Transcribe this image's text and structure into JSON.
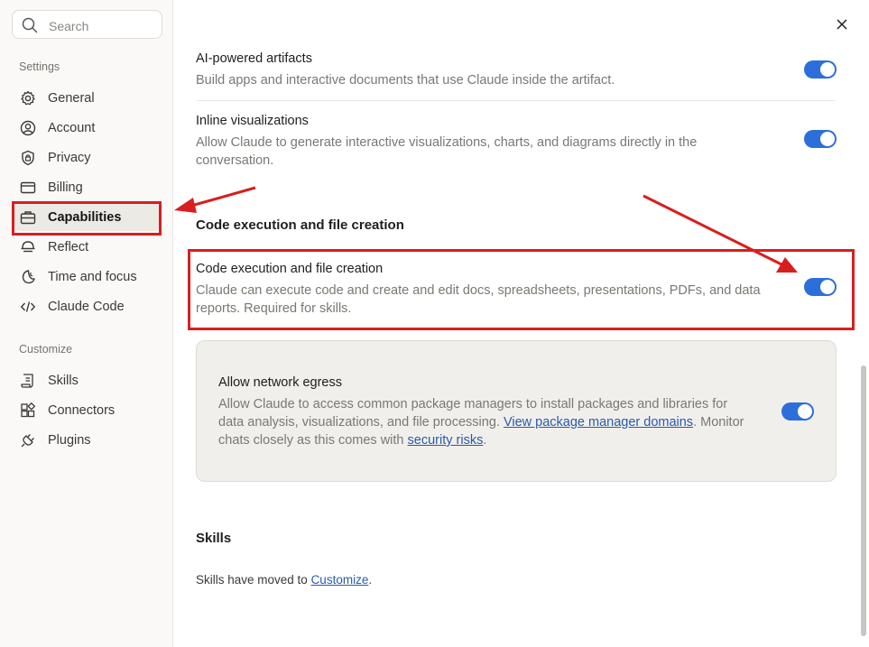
{
  "search": {
    "placeholder": "Search"
  },
  "sidebar": {
    "settings_label": "Settings",
    "customize_label": "Customize",
    "items": [
      {
        "label": "General",
        "icon": "gear-icon"
      },
      {
        "label": "Account",
        "icon": "user-circle-icon"
      },
      {
        "label": "Privacy",
        "icon": "shield-lock-icon"
      },
      {
        "label": "Billing",
        "icon": "credit-card-icon"
      },
      {
        "label": "Capabilities",
        "icon": "briefcase-icon",
        "active": true
      },
      {
        "label": "Reflect",
        "icon": "reflect-icon"
      },
      {
        "label": "Time and focus",
        "icon": "moon-clock-icon"
      },
      {
        "label": "Claude Code",
        "icon": "code-icon"
      }
    ],
    "customize_items": [
      {
        "label": "Skills",
        "icon": "scroll-icon"
      },
      {
        "label": "Connectors",
        "icon": "grid-icon"
      },
      {
        "label": "Plugins",
        "icon": "plug-icon"
      }
    ]
  },
  "main": {
    "artifacts": {
      "title": "AI-powered artifacts",
      "desc": "Build apps and interactive documents that use Claude inside the artifact.",
      "enabled": true
    },
    "inline_viz": {
      "title": "Inline visualizations",
      "desc_line1": "Allow Claude to generate interactive visualizations, charts, and diagrams directly in the",
      "desc_line2": "conversation.",
      "enabled": true
    },
    "code_section": {
      "heading": "Code execution and file creation",
      "title": "Code execution and file creation",
      "desc_line1": "Claude can execute code and create and edit docs, spreadsheets, presentations, PDFs, and data",
      "desc_line2": "reports. Required for skills.",
      "enabled": true
    },
    "egress": {
      "title": "Allow network egress",
      "line1": "Allow Claude to access common package managers to install packages and libraries for",
      "line2_pre": "data analysis, visualizations, and file processing. ",
      "line2_link": "View package manager domains",
      "line2_post": ". Monitor",
      "line3_pre": "chats closely as this comes with ",
      "line3_link": "security risks",
      "line3_post": ".",
      "enabled": true
    },
    "skills": {
      "heading": "Skills",
      "text_pre": "Skills have moved to ",
      "text_link": "Customize",
      "text_post": "."
    }
  },
  "colors": {
    "toggle_on": "#2c6fdb",
    "highlight": "#d91e1e",
    "link": "#2b5aa8"
  }
}
